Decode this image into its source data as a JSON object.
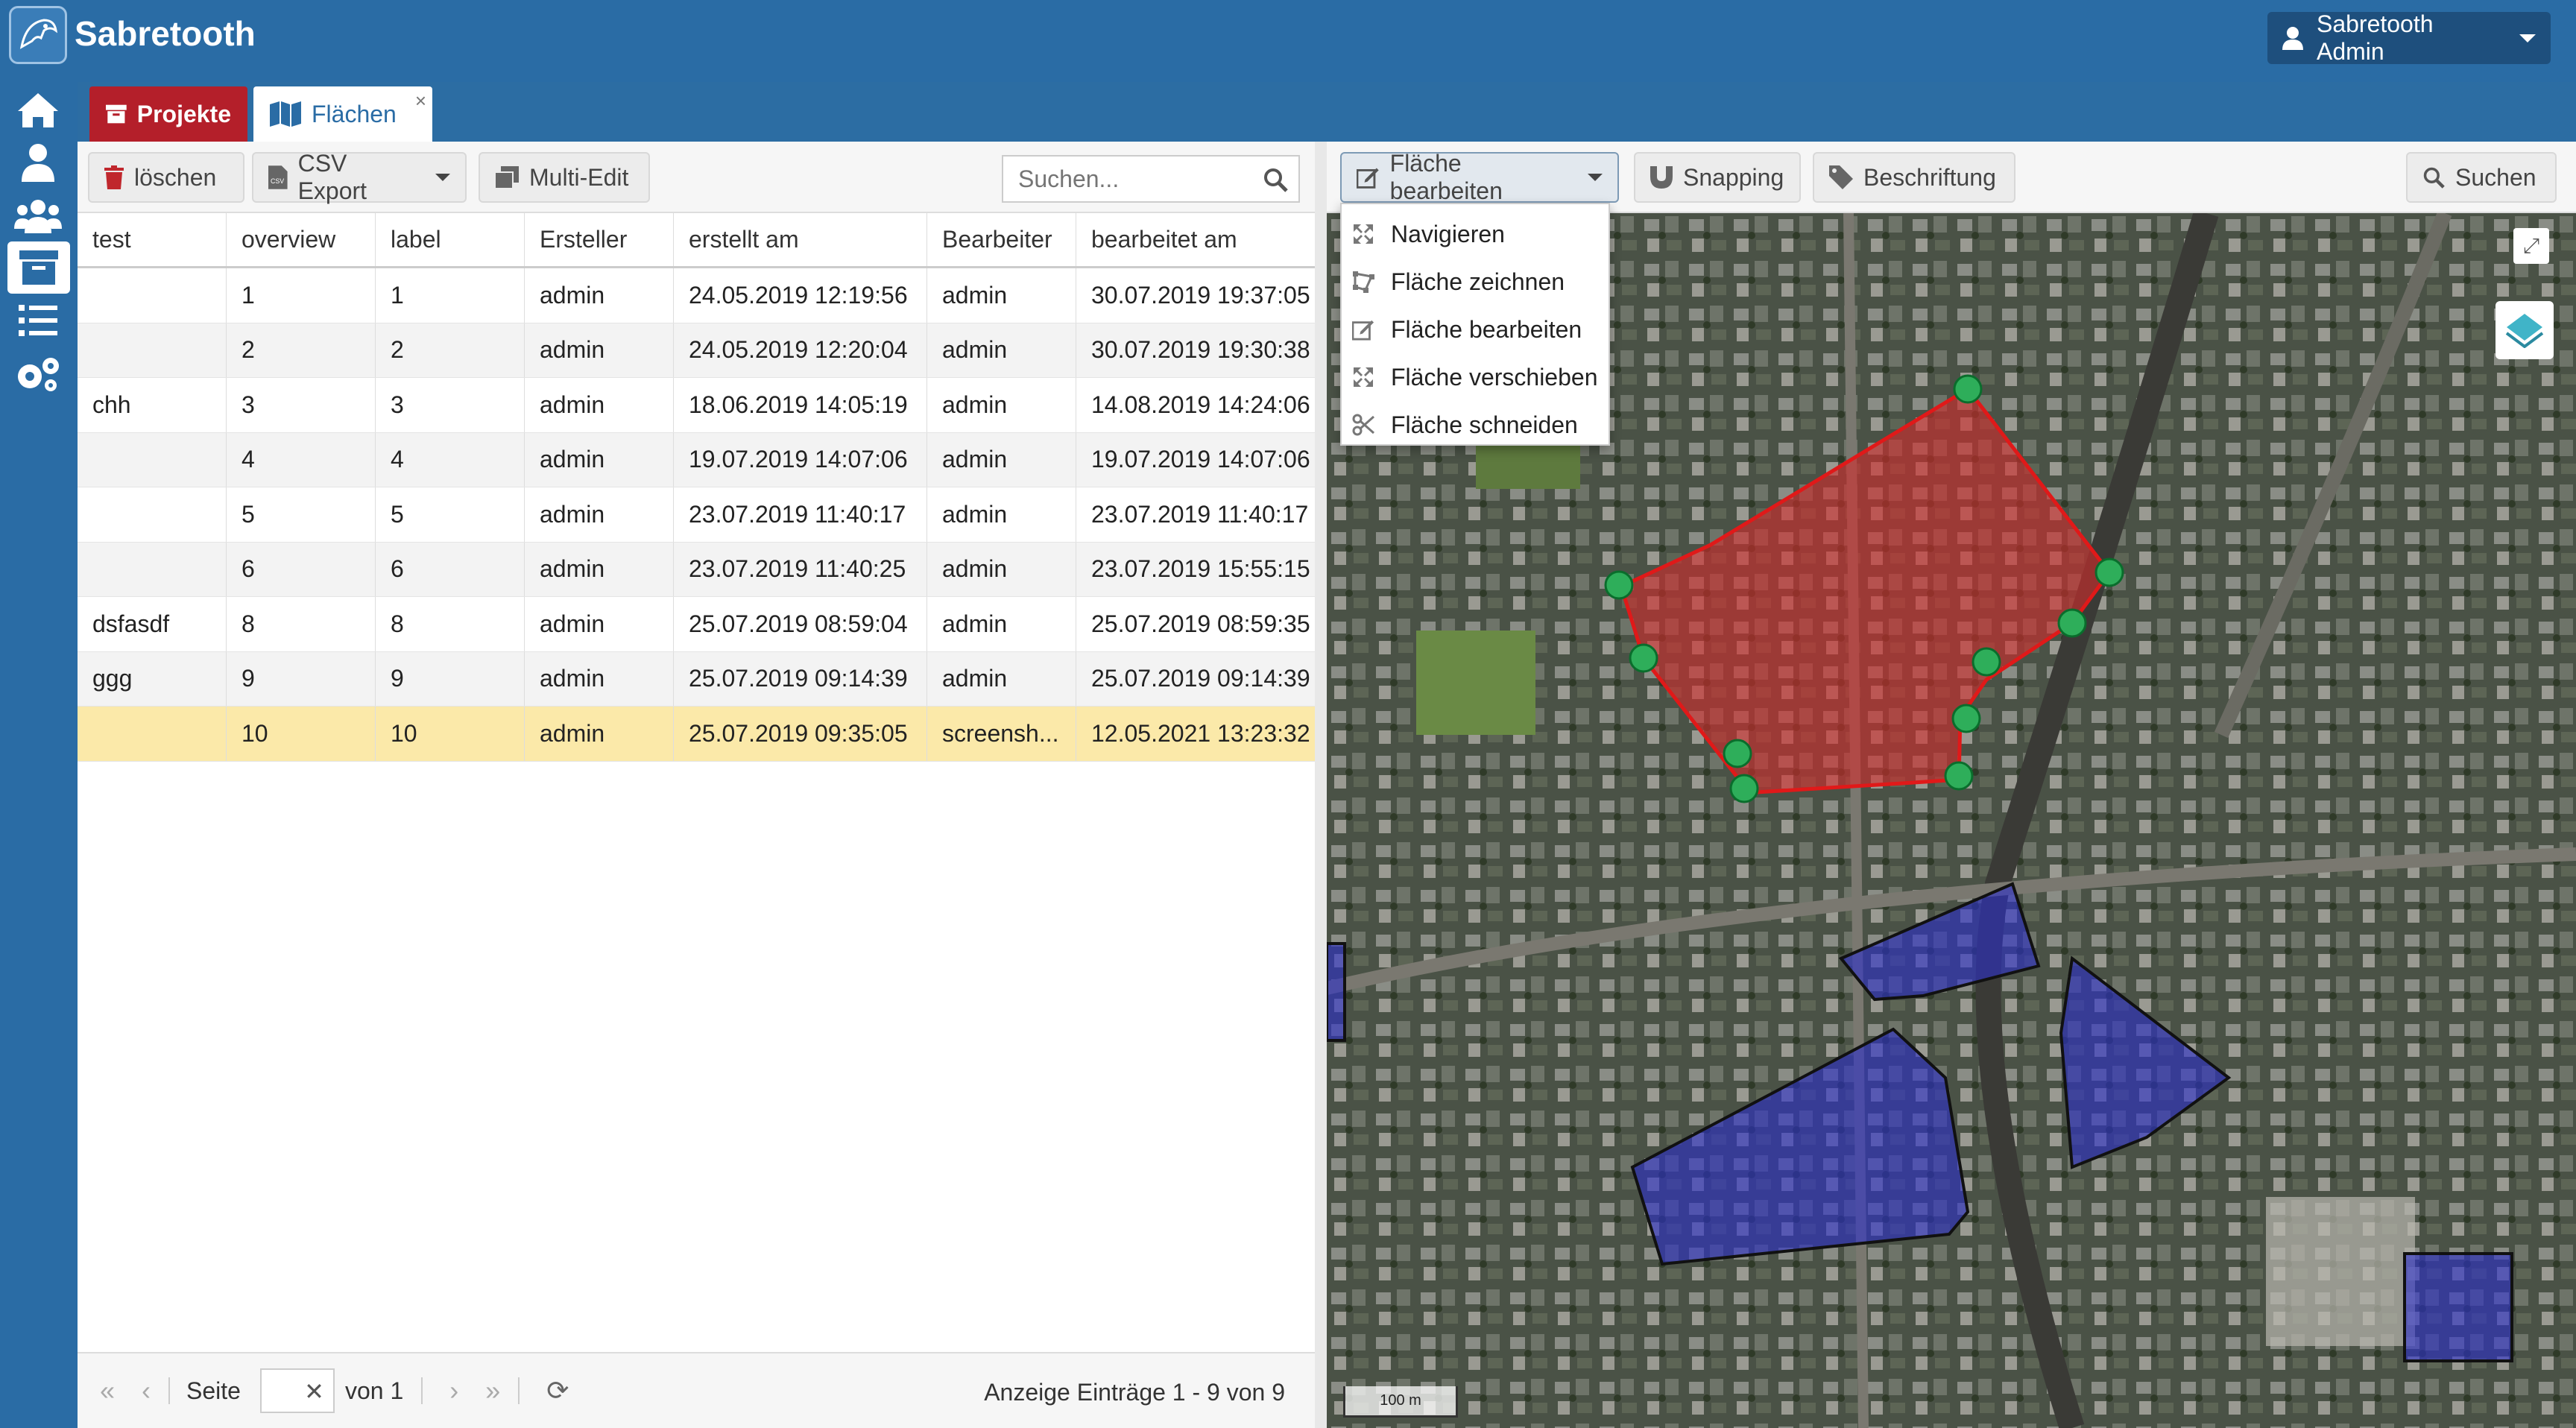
{
  "header": {
    "app_title": "Sabretooth",
    "user_label": "Sabretooth Admin"
  },
  "tabs": [
    {
      "label": "Projekte",
      "icon": "archive-icon",
      "color": "#b41f2a"
    },
    {
      "label": "Flächen",
      "icon": "map-icon"
    }
  ],
  "sidebar": {
    "items": [
      "home-icon",
      "user-icon",
      "users-icon",
      "archive-icon",
      "list-icon",
      "gears-icon"
    ]
  },
  "left_toolbar": {
    "delete_label": "löschen",
    "csv_label": "CSV Export",
    "multiedit_label": "Multi-Edit",
    "search_placeholder": "Suchen..."
  },
  "grid": {
    "columns": [
      "test",
      "overview",
      "label",
      "Ersteller",
      "erstellt am",
      "Bearbeiter",
      "bearbeitet am"
    ],
    "rows": [
      [
        "",
        "1",
        "1",
        "admin",
        "24.05.2019 12:19:56",
        "admin",
        "30.07.2019 19:37:05"
      ],
      [
        "",
        "2",
        "2",
        "admin",
        "24.05.2019 12:20:04",
        "admin",
        "30.07.2019 19:30:38"
      ],
      [
        "chh",
        "3",
        "3",
        "admin",
        "18.06.2019 14:05:19",
        "admin",
        "14.08.2019 14:24:06"
      ],
      [
        "",
        "4",
        "4",
        "admin",
        "19.07.2019 14:07:06",
        "admin",
        "19.07.2019 14:07:06"
      ],
      [
        "",
        "5",
        "5",
        "admin",
        "23.07.2019 11:40:17",
        "admin",
        "23.07.2019 11:40:17"
      ],
      [
        "",
        "6",
        "6",
        "admin",
        "23.07.2019 11:40:25",
        "admin",
        "23.07.2019 15:55:15"
      ],
      [
        "dsfasdf",
        "8",
        "8",
        "admin",
        "25.07.2019 08:59:04",
        "admin",
        "25.07.2019 08:59:35"
      ],
      [
        "ggg",
        "9",
        "9",
        "admin",
        "25.07.2019 09:14:39",
        "admin",
        "25.07.2019 09:14:39"
      ],
      [
        "",
        "10",
        "10",
        "admin",
        "25.07.2019 09:35:05",
        "screensh...",
        "12.05.2021 13:23:32"
      ]
    ],
    "selected_row": 8
  },
  "pager": {
    "page_label": "Seite",
    "of_label": "von 1",
    "info": "Anzeige Einträge 1 - 9 von 9"
  },
  "map_toolbar": {
    "edit_label": "Fläche bearbeiten",
    "snapping_label": "Snapping",
    "label_label": "Beschriftung",
    "search_label": "Suchen"
  },
  "edit_menu": [
    {
      "label": "Navigieren",
      "icon": "arrows-icon"
    },
    {
      "label": "Fläche zeichnen",
      "icon": "draw-polygon-icon"
    },
    {
      "label": "Fläche bearbeiten",
      "icon": "edit-icon"
    },
    {
      "label": "Fläche verschieben",
      "icon": "move-icon"
    },
    {
      "label": "Fläche schneiden",
      "icon": "scissors-icon"
    }
  ],
  "map": {
    "scale_label": "100 m",
    "active_polygon_color": "#d42c2c",
    "polygon_color": "#2b2ec9",
    "vertex_color": "#2eae5a"
  }
}
